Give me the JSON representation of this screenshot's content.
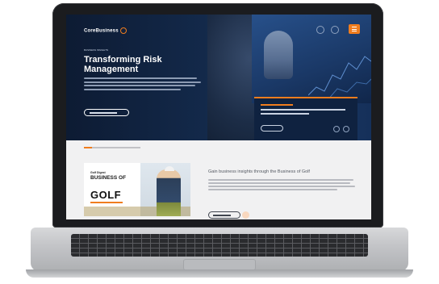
{
  "site": {
    "logo_text": "CoreBusiness",
    "logo_tagline": "",
    "hero": {
      "kicker": "BUSINESS INSIGHTS",
      "title": "Transforming Risk Management",
      "button_label": ""
    },
    "featured_card": {
      "label": "",
      "text": "",
      "button_label": ""
    },
    "section": {
      "breadcrumb": "",
      "promo_small": "Golf Digest",
      "promo_title": "BUSINESS OF",
      "promo_big": "GOLF",
      "heading": "Gain business insights through the Business of Golf",
      "button_label": ""
    }
  },
  "colors": {
    "accent": "#f07d1e",
    "hero_navy": "#13294a",
    "device_dark": "#1b1c1f"
  },
  "icons": [
    "search-icon",
    "user-icon",
    "menu-icon",
    "arrow-left-icon",
    "arrow-right-icon"
  ]
}
